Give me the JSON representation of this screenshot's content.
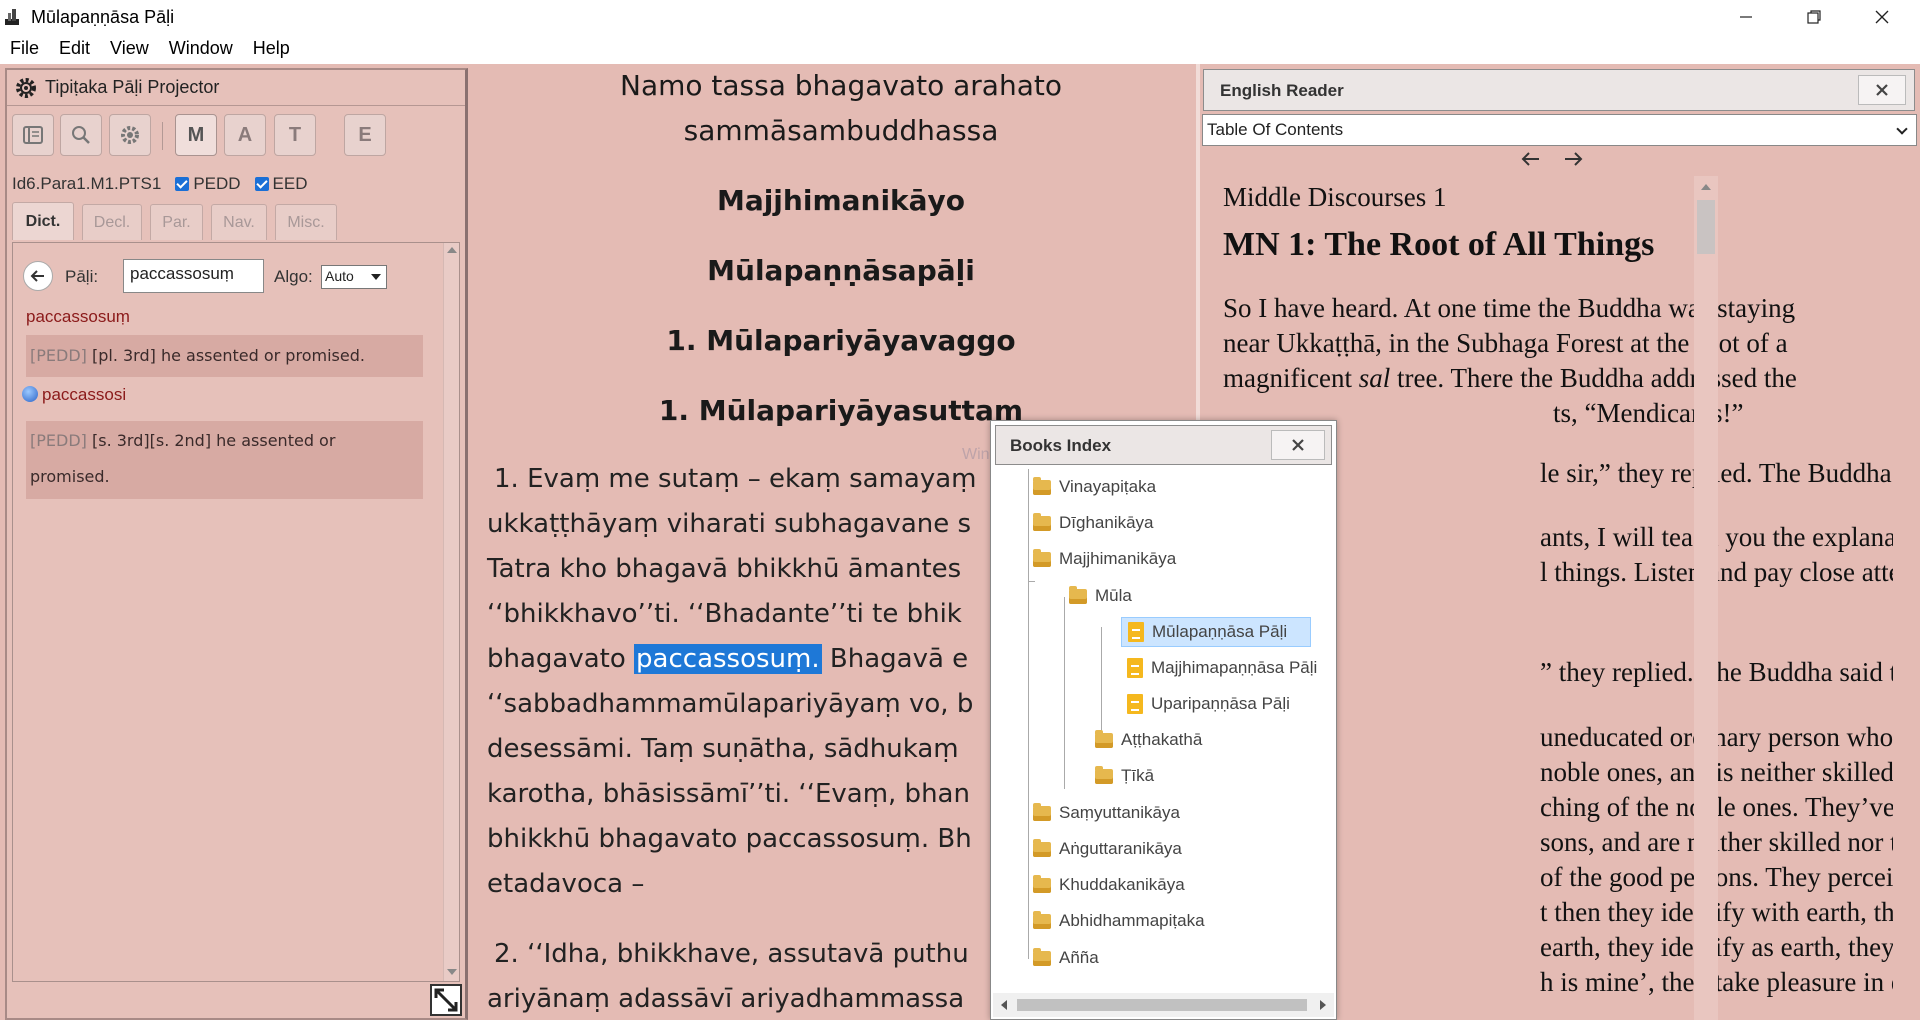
{
  "window": {
    "title": "Mūlapaṇṇāsa Pāḷi"
  },
  "menu": [
    "File",
    "Edit",
    "View",
    "Window",
    "Help"
  ],
  "left_panel": {
    "title": "Tipiṭaka Pāḷi Projector",
    "toolbar_letters": {
      "m": "M",
      "a": "A",
      "t": "T",
      "e": "E"
    },
    "ref": "Id6.Para1.M1.PTS1",
    "pedd_label": "PEDD",
    "eed_label": "EED",
    "tabs": [
      "Dict.",
      "Decl.",
      "Par.",
      "Nav.",
      "Misc."
    ],
    "pali_label": "Pāḷi:",
    "pali_value": "paccassosuṃ",
    "algo_label": "Algo:",
    "algo_value": "Auto",
    "entries": [
      {
        "headword": "paccassosuṃ",
        "source": "[PEDD]",
        "definition": "[pl. 3rd] he assented or promised."
      },
      {
        "headword": "paccassosi",
        "source": "[PEDD]",
        "definition": "[s. 3rd][s. 2nd] he assented or promised."
      }
    ]
  },
  "pali_text": {
    "invocation_1": "Namo tassa bhagavato arahato",
    "invocation_2": "sammāsambuddhassa",
    "title_1": "Majjhimanikāyo",
    "title_2": "Mūlapaṇṇāsapāḷi",
    "title_3": "1. Mūlapariyāyavaggo",
    "title_4": "1. Mūlapariyāyasuttaṃ",
    "lines": [
      "1. Evaṃ me sutaṃ – ekaṃ samayaṃ",
      "ukkaṭṭhāyaṃ viharati subhagavane s",
      "Tatra kho bhagavā bhikkhū āmantes",
      "‘‘bhikkhavo’’ti. ‘‘Bhadante’’ti te bhik",
      "bhagavato",
      "‘‘sabbadhammamūlapariyāyaṃ vo, b",
      "desessāmi. Taṃ suṇātha, sādhukaṃ",
      "karotha, bhāsissāmī’’ti. ‘‘Evaṃ, bhan",
      "bhikkhū bhagavato paccassosuṃ. Bh",
      "etadavoca –",
      "2. ‘‘Idha, bhikkhave, assutavā puthu",
      "ariyānaṃ adassāvī ariyadhammassa"
    ],
    "highlight": "paccassosuṃ.",
    "after_highlight": "Bhagavā e"
  },
  "english_reader": {
    "title": "English Reader",
    "toc": "Table Of Contents",
    "book_title": "Middle Discourses 1",
    "sutta_title": "MN 1: The Root of All Things",
    "p1_a": "So I have heard. At one time the Buddha was staying",
    "p1_b": "near Ukkaṭṭhā, in the Subhaga Forest at the root of a",
    "p1_c_pre": "magnificent",
    "p1_c_em": "sal",
    "p1_c_post": "tree. There the Buddha addressed the",
    "p1_d": "ts, “Mendicants!”",
    "p2": "le sir,” they replied. The Buddha said this:",
    "p3_a": "ants, I will teach you the explanation of the",
    "p3_b": "l things. Listen and pay close attention, I will",
    "p4": "” they replied. The Buddha said this:",
    "p5": [
      "uneducated ordinary person who has not",
      "noble ones, and is neither skilled nor trained",
      "ching of the noble ones. They’ve not seen",
      "sons, and are neither skilled nor trained in the",
      "of the good persons. They perceive earth as",
      "t then they identify with earth, they identify",
      " earth, they identify as earth, they identify",
      "h is mine’, they take pleasure in earth. Why is"
    ]
  },
  "books_index": {
    "title": "Books Index",
    "ghost_text": "Window Tip",
    "nodes": [
      {
        "label": "Vinayapiṭaka",
        "type": "folder",
        "level": 0
      },
      {
        "label": "Dīghanikāya",
        "type": "folder",
        "level": 0
      },
      {
        "label": "Majjhimanikāya",
        "type": "folder",
        "level": 0
      },
      {
        "label": "Mūla",
        "type": "folder",
        "level": 1
      },
      {
        "label": "Mūlapaṇṇāsa Pāḷi",
        "type": "doc",
        "level": 2,
        "selected": true
      },
      {
        "label": "Majjhimapaṇṇāsa Pāḷi",
        "type": "doc",
        "level": 2
      },
      {
        "label": "Uparipaṇṇāsa Pāḷi",
        "type": "doc",
        "level": 2
      },
      {
        "label": "Aṭṭhakathā",
        "type": "folder",
        "level": 1
      },
      {
        "label": "Ṭīkā",
        "type": "folder",
        "level": 1
      },
      {
        "label": "Saṃyuttanikāya",
        "type": "folder",
        "level": 0
      },
      {
        "label": "Aṅguttaranikāya",
        "type": "folder",
        "level": 0
      },
      {
        "label": "Khuddakanikāya",
        "type": "folder",
        "level": 0
      },
      {
        "label": "Abhidhammapiṭaka",
        "type": "folder",
        "level": 0
      },
      {
        "label": "Añña",
        "type": "folder",
        "level": 0
      }
    ]
  },
  "colors": {
    "background": "#e4bbb4",
    "highlight": "#1e78d7",
    "headword": "#8b1a1a",
    "selected_node": "#cce5ff"
  }
}
